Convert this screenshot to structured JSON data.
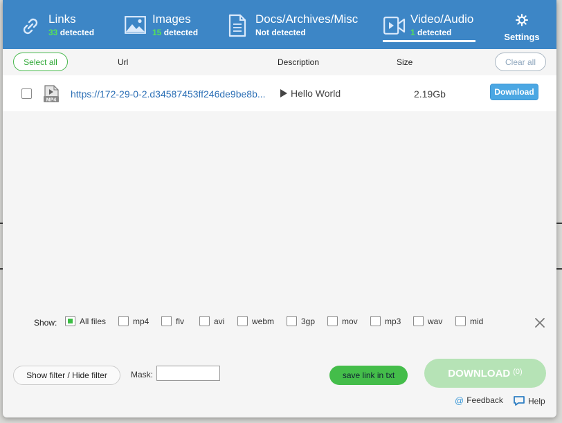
{
  "tabs": [
    {
      "title": "Links",
      "count": "33",
      "suffix": "detected"
    },
    {
      "title": "Images",
      "count": "15",
      "suffix": "detected"
    },
    {
      "title": "Docs/Archives/Misc",
      "status": "Not detected"
    },
    {
      "title": "Video/Audio",
      "count": "1",
      "suffix": "detected",
      "active": true
    }
  ],
  "settings": {
    "label": "Settings",
    "icon": "gear-icon"
  },
  "columns": {
    "select_all": "Select all",
    "url": "Url",
    "description": "Description",
    "size": "Size",
    "clear_all": "Clear all"
  },
  "files": [
    {
      "type_badge": "MP4",
      "url": "https://172-29-0-2.d34587453ff246de9be8b...",
      "description": "Hello World",
      "size": "2.19Gb",
      "download_label": "Download"
    }
  ],
  "filter": {
    "show_label": "Show:",
    "options": [
      {
        "label": "All files",
        "checked": true
      },
      {
        "label": "mp4",
        "checked": false
      },
      {
        "label": "flv",
        "checked": false
      },
      {
        "label": "avi",
        "checked": false
      },
      {
        "label": "webm",
        "checked": false
      },
      {
        "label": "3gp",
        "checked": false
      },
      {
        "label": "mov",
        "checked": false
      },
      {
        "label": "mp3",
        "checked": false
      },
      {
        "label": "wav",
        "checked": false
      },
      {
        "label": "mid",
        "checked": false
      }
    ]
  },
  "bottom": {
    "toggle_filter": "Show filter / Hide filter",
    "mask_label": "Mask:",
    "mask_value": "",
    "save_txt": "save link in txt",
    "download_all": "DOWNLOAD",
    "download_count": "(0)",
    "feedback": "Feedback",
    "help": "Help"
  },
  "colors": {
    "header": "#3d86c6",
    "count_green": "#55e05a",
    "link_blue": "#2a6eb5",
    "save_green": "#44bd4a",
    "download_disabled": "#b6e3b6"
  }
}
